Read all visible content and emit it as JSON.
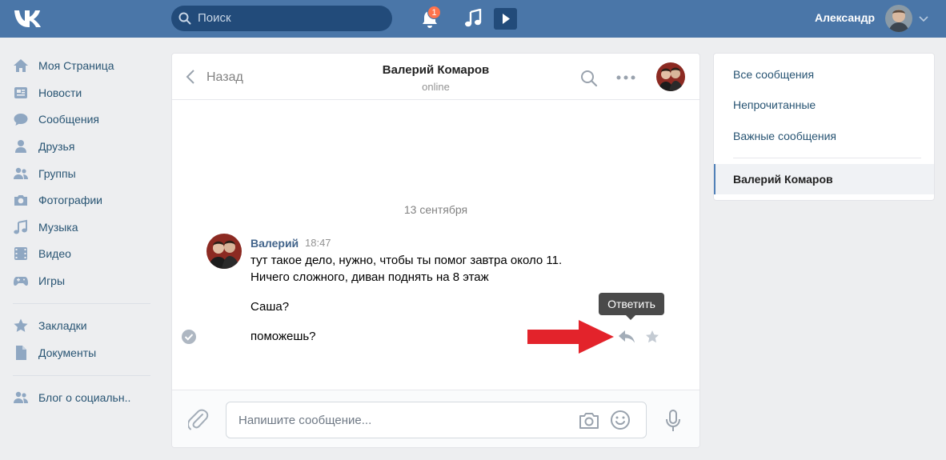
{
  "header": {
    "logo": "vk-logo",
    "search_placeholder": "Поиск",
    "notifications_count": "1",
    "username": "Александр"
  },
  "nav": {
    "items": [
      {
        "label": "Моя Страница",
        "icon": "home-icon"
      },
      {
        "label": "Новости",
        "icon": "news-icon"
      },
      {
        "label": "Сообщения",
        "icon": "messages-icon"
      },
      {
        "label": "Друзья",
        "icon": "friends-icon"
      },
      {
        "label": "Группы",
        "icon": "groups-icon"
      },
      {
        "label": "Фотографии",
        "icon": "camera-icon"
      },
      {
        "label": "Музыка",
        "icon": "music-icon"
      },
      {
        "label": "Видео",
        "icon": "video-icon"
      },
      {
        "label": "Игры",
        "icon": "games-icon"
      },
      {
        "label": "Закладки",
        "icon": "star-icon"
      },
      {
        "label": "Документы",
        "icon": "document-icon"
      },
      {
        "label": "Блог о социальн..",
        "icon": "group-icon"
      }
    ]
  },
  "chat": {
    "back_label": "Назад",
    "peer_name": "Валерий Комаров",
    "peer_status": "online",
    "date_separator": "13 сентября",
    "message": {
      "author": "Валерий",
      "time": "18:47",
      "lines": [
        "тут такое дело, нужно, чтобы ты помог завтра около 11.",
        "Ничего сложного, диван поднять на 8 этаж",
        "Саша?",
        "поможешь?"
      ]
    },
    "tooltip": "Ответить",
    "input_placeholder": "Напишите сообщение..."
  },
  "right_panel": {
    "items": [
      "Все сообщения",
      "Непрочитанные",
      "Важные сообщения"
    ],
    "active_conversation": "Валерий Комаров"
  },
  "colors": {
    "header": "#4a76a8",
    "link": "#285473",
    "author": "#42648b",
    "annotation_arrow": "#e3232b"
  }
}
